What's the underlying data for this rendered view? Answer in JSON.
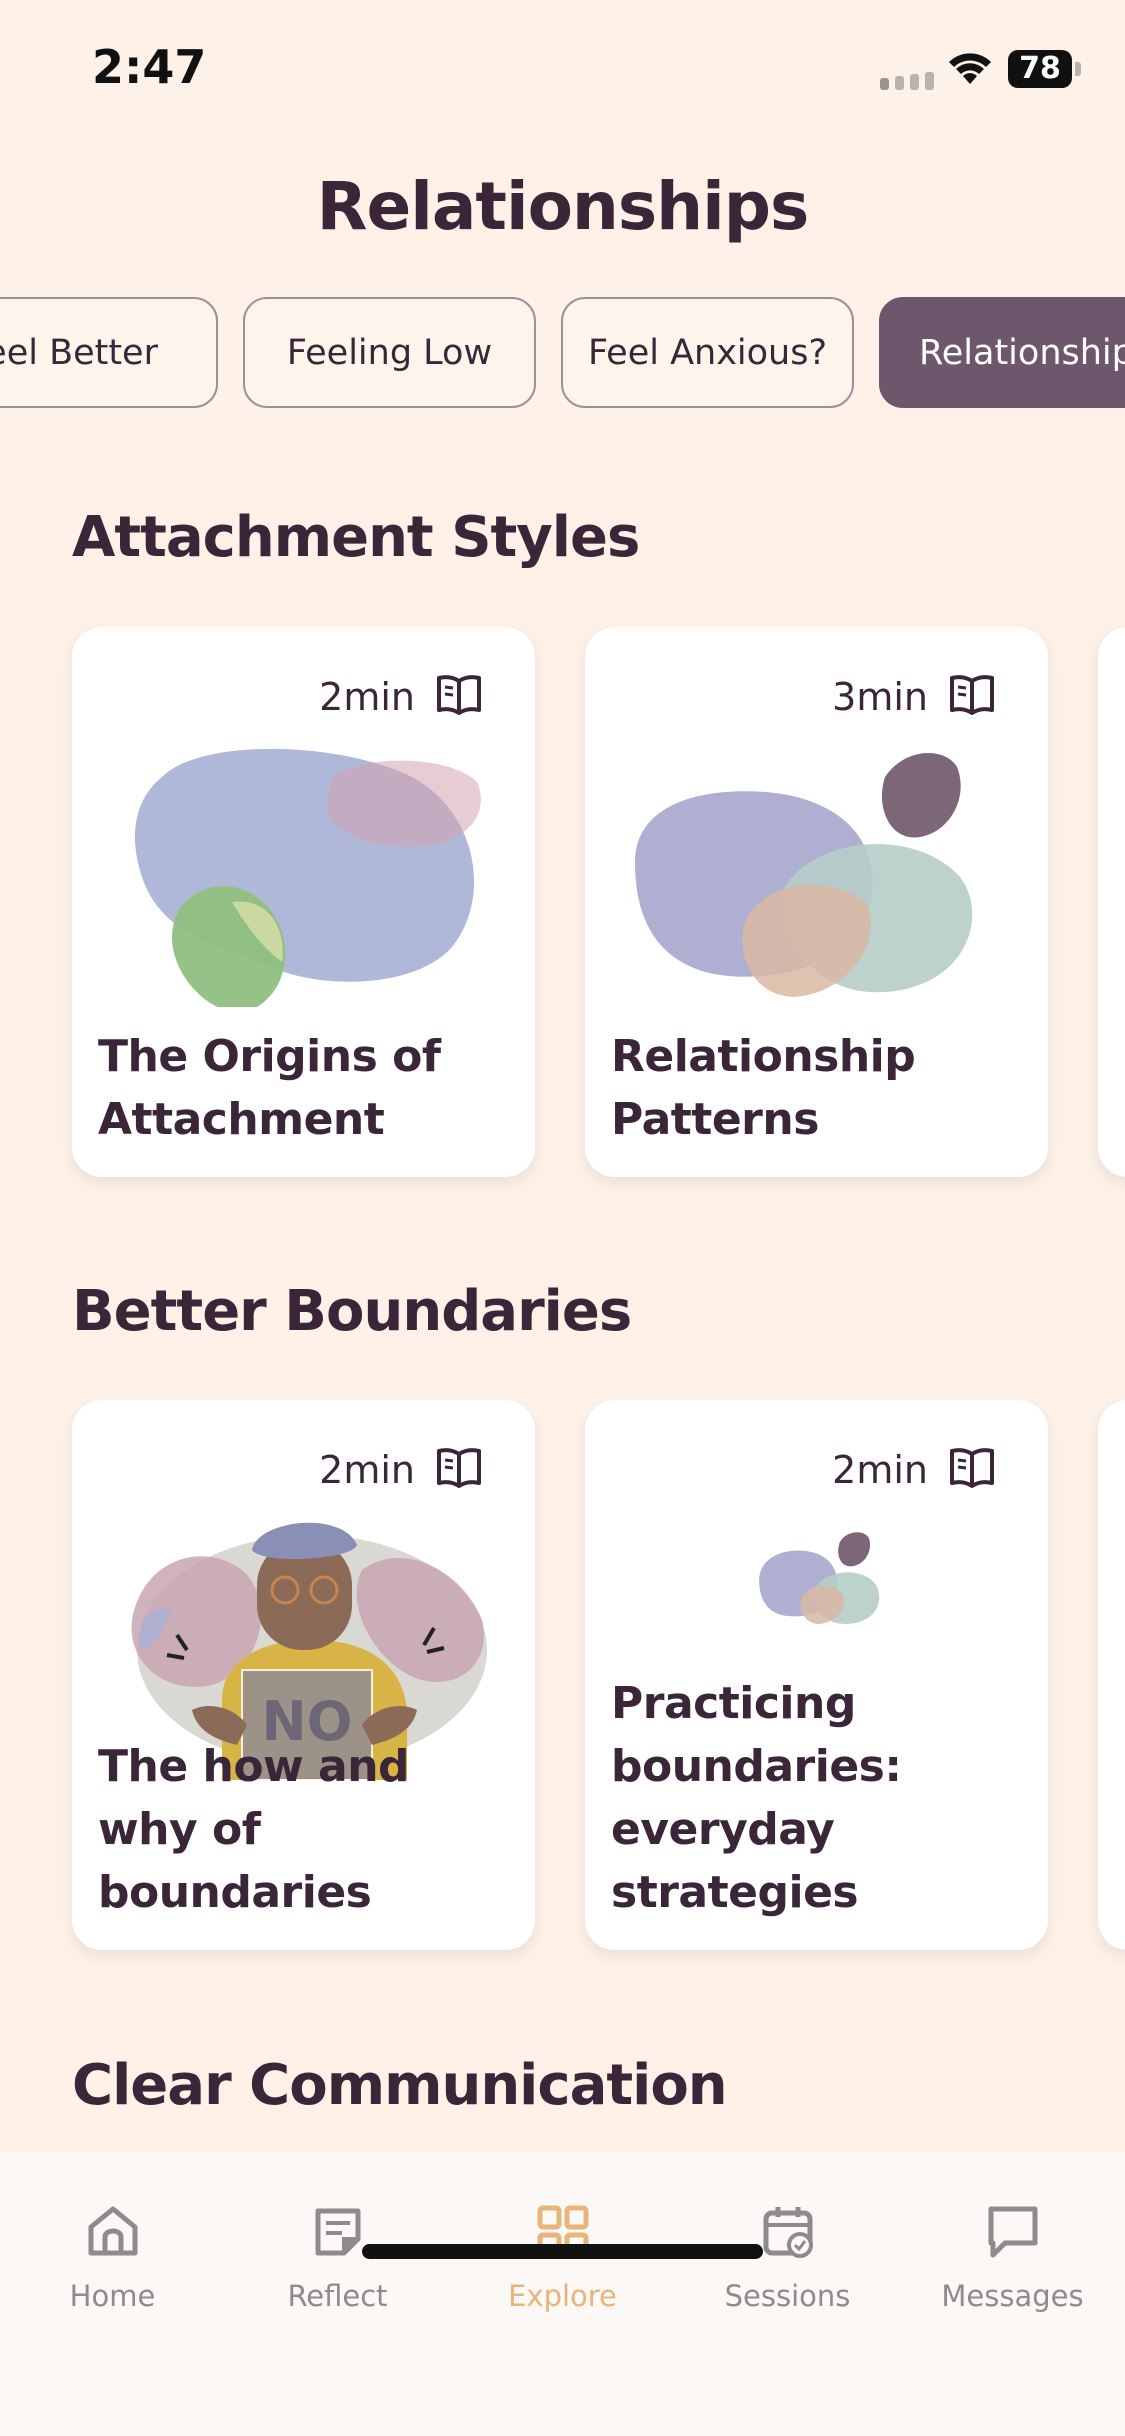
{
  "status_bar": {
    "time": "2:47",
    "battery": "78"
  },
  "header": {
    "title": "Relationships"
  },
  "filters": [
    {
      "label": "Feel Better",
      "active": false
    },
    {
      "label": "Feeling Low",
      "active": false
    },
    {
      "label": "Feel Anxious?",
      "active": false
    },
    {
      "label": "Relationships",
      "active": true
    }
  ],
  "sections": [
    {
      "title": "Attachment Styles",
      "cards": [
        {
          "duration": "2min",
          "title": "The Origins of Attachment",
          "icon": "book-open-icon"
        },
        {
          "duration": "3min",
          "title": "Relationship Patterns",
          "icon": "book-open-icon"
        }
      ]
    },
    {
      "title": "Better Boundaries",
      "cards": [
        {
          "duration": "2min",
          "title": "The how and why of boundaries",
          "icon": "book-open-icon"
        },
        {
          "duration": "2min",
          "title": "Practicing boundaries: everyday strategies",
          "icon": "book-open-icon"
        }
      ]
    },
    {
      "title": "Clear Communication"
    }
  ],
  "tabbar": {
    "items": [
      {
        "label": "Home",
        "icon": "home-icon",
        "active": false
      },
      {
        "label": "Reflect",
        "icon": "note-icon",
        "active": false
      },
      {
        "label": "Explore",
        "icon": "grid-icon",
        "active": true
      },
      {
        "label": "Sessions",
        "icon": "calendar-check-icon",
        "active": false
      },
      {
        "label": "Messages",
        "icon": "chat-bubble-icon",
        "active": false
      }
    ]
  },
  "colors": {
    "background": "#fdf1e8",
    "accent": "#e8b37c",
    "active_chip": "#6e566c",
    "text": "#3a2638"
  }
}
